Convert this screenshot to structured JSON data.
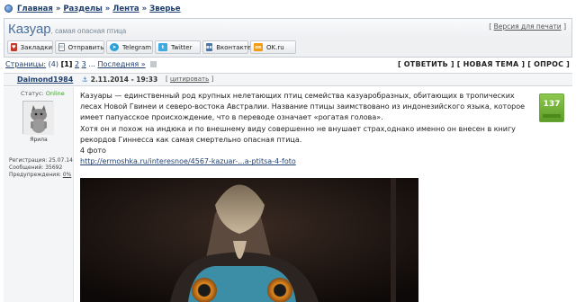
{
  "breadcrumb": {
    "items": [
      "Главная",
      "Разделы",
      "Лента",
      "Зверье"
    ],
    "separator": "»"
  },
  "topic": {
    "title": "Казуар",
    "subtitle": ", самая опасная птица",
    "print_link": "Версия для печати"
  },
  "share": {
    "buttons": [
      {
        "label": "Закладки",
        "icon": "bookmarks-icon",
        "color": "#c0392b"
      },
      {
        "label": "Отправить",
        "icon": "mail-icon",
        "color": "#7a8a99"
      },
      {
        "label": "Telegram",
        "icon": "telegram-icon",
        "color": "#2aa3d8"
      },
      {
        "label": "Twitter",
        "icon": "twitter-icon",
        "color": "#3fa9e0"
      },
      {
        "label": "Вконтакте",
        "icon": "vk-icon",
        "color": "#4a76a8"
      },
      {
        "label": "OK.ru",
        "icon": "odnoklassniki-icon",
        "color": "#f39c12"
      }
    ]
  },
  "pagination": {
    "label": "Страницы:",
    "count": "(4)",
    "current": "[1]",
    "pages": [
      "2",
      "3"
    ],
    "ellipsis": "...",
    "last": "Последняя »",
    "actions": [
      "[ ОТВЕТИТЬ ]",
      "[ НОВАЯ ТЕМА ]",
      "[ ОПРОС ]"
    ]
  },
  "post": {
    "author": "Daimond1984",
    "date": "2.11.2014 - 19:33",
    "quote": "цитировать",
    "user": {
      "status_label": "Статус:",
      "status_value": "Online",
      "rank": "Ярила",
      "registered": "Регистрация: 25.07.14",
      "messages": "Сообщений: 35692",
      "warnings_label": "Предупреждения:",
      "warnings_value": "0%"
    },
    "rating": "137",
    "paragraphs": [
      "Казуары — единственный род крупных нелетающих птиц семейства казуаробразных, обитающих в тропических лесах Новой Гвинеи и северо-востока Австралии. Название птицы заимствовано из индонезийского языка, которое имеет папуасское происхождение, что в переводе означает «рогатая голова».",
      "Хотя он и похож на индюка и по внешнему виду совершенно не внушает страх,однако именно он внесен в книгу рекордов Гиннесса как самая смертельно опасная птица.",
      "4 фото"
    ],
    "link": "http://ermoshka.ru/interesnoe/4567-kazuar-...a-ptitsa-4-foto"
  }
}
